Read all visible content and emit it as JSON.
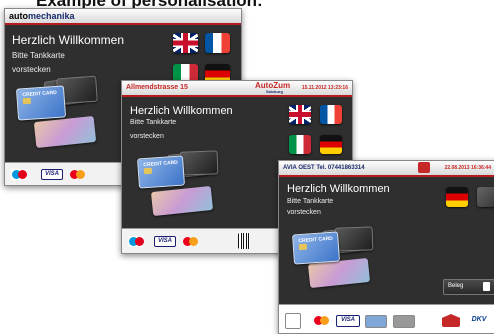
{
  "heading": "Example of personalisation:",
  "screen1": {
    "brand_prefix": "auto",
    "brand_suffix": "mechanika",
    "welcome": "Herzlich Willkommen",
    "line1": "Bitte Tankkarte",
    "line2": "vorstecken",
    "card_text": "CREDIT CARD",
    "payment": [
      "Maestro",
      "VISA",
      "MasterCard"
    ]
  },
  "screen2": {
    "address": "Allmendstrasse 15",
    "brand": "AutoZum",
    "brand_sub": "Salzburg",
    "timestamp": "15.11.2012 13:23:16",
    "welcome": "Herzlich Willkommen",
    "line1": "Bitte Tankkarte",
    "line2": "vorstecken",
    "card_text": "CREDIT CARD",
    "payment": [
      "Maestro",
      "VISA",
      "MasterCard"
    ]
  },
  "screen3": {
    "station": "AVIA OEST Tel. 07441863314",
    "timestamp": "22.08.2013 16:36:44",
    "welcome": "Herzlich Willkommen",
    "line1": "Bitte Tankkarte",
    "line2": "vorstecken",
    "card_text": "CREDIT CARD",
    "beleg": "Beleg",
    "payment": [
      "MasterCard",
      "VISA",
      "DKV"
    ]
  }
}
